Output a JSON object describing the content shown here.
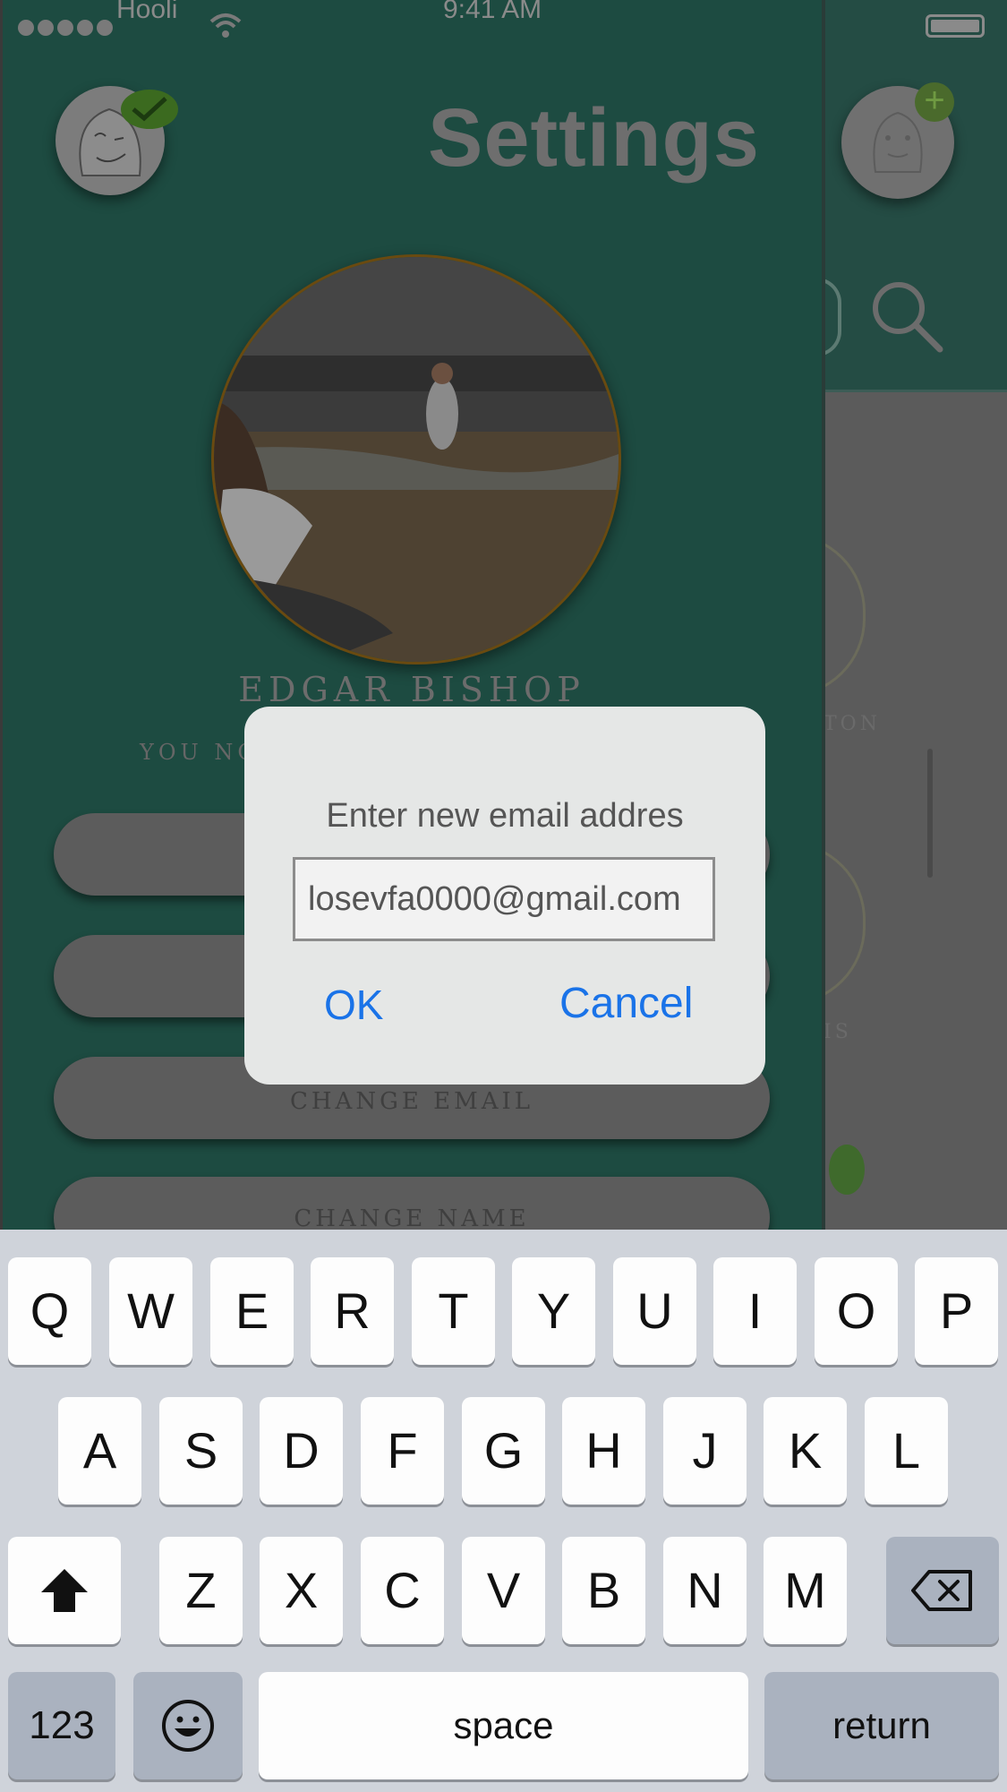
{
  "status_bar": {
    "carrier": "Hooli",
    "time": "9:41 AM"
  },
  "header": {
    "title": "Settings"
  },
  "profile": {
    "name": "EDGAR BISHOP",
    "subtitle": "YOU NO"
  },
  "menu": {
    "change_email": "CHANGE EMAIL",
    "change_name": "CHANGE NAME"
  },
  "background_list": {
    "item1_partial": "TON",
    "item2_partial": "IS"
  },
  "alert": {
    "title": "Enter new email addres",
    "email_value": "losevfa0000@gmail.com",
    "ok_label": "OK",
    "cancel_label": "Cancel"
  },
  "keyboard": {
    "row1": [
      "Q",
      "W",
      "E",
      "R",
      "T",
      "Y",
      "U",
      "I",
      "O",
      "P"
    ],
    "row2": [
      "A",
      "S",
      "D",
      "F",
      "G",
      "H",
      "J",
      "K",
      "L"
    ],
    "row3": [
      "Z",
      "X",
      "C",
      "V",
      "B",
      "N",
      "M"
    ],
    "num_label": "123",
    "space_label": "space",
    "return_label": "return"
  },
  "colors": {
    "accent_blue": "#1a73e8",
    "panel_teal": "#1d4b41",
    "keyboard_bg": "#cfd3da"
  }
}
